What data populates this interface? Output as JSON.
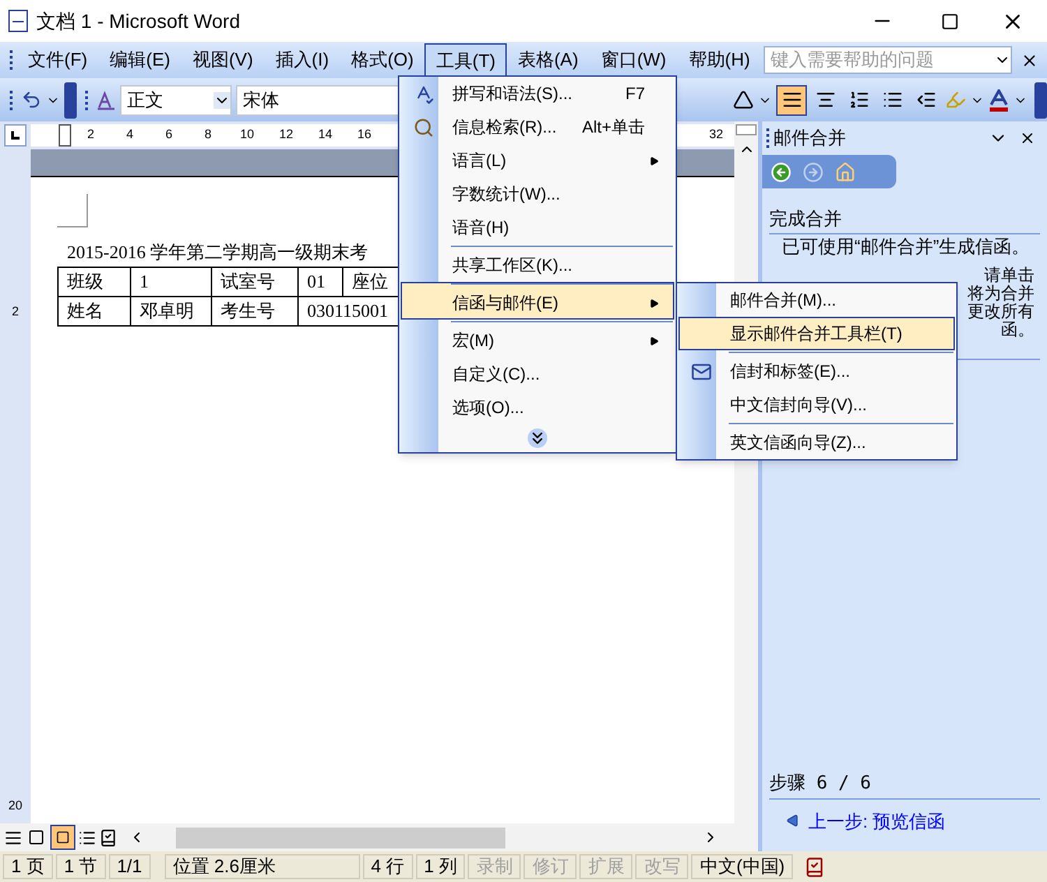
{
  "window": {
    "title": "文档 1 - Microsoft Word"
  },
  "menu_bar": {
    "items": [
      {
        "label": "文件(F)",
        "selected": false
      },
      {
        "label": "编辑(E)",
        "selected": false
      },
      {
        "label": "视图(V)",
        "selected": false
      },
      {
        "label": "插入(I)",
        "selected": false
      },
      {
        "label": "格式(O)",
        "selected": false
      },
      {
        "label": "工具(T)",
        "selected": true
      },
      {
        "label": "表格(A)",
        "selected": false
      },
      {
        "label": "窗口(W)",
        "selected": false
      },
      {
        "label": "帮助(H)",
        "selected": false
      }
    ],
    "help_box": {
      "placeholder": "键入需要帮助的问题"
    }
  },
  "toolbar": {
    "style": "正文",
    "font": "宋体",
    "justify_selected": true
  },
  "ruler": {
    "labels": [
      "2",
      "4",
      "6",
      "8",
      "10",
      "12",
      "14",
      "16"
    ],
    "right_label": "32",
    "vertical_labels": [
      "2",
      "20"
    ]
  },
  "document": {
    "heading": "2015-2016 学年第二学期高一级期末考",
    "table": [
      [
        "班级",
        "1",
        "试室号",
        "01",
        "座位"
      ],
      [
        "姓名",
        "邓卓明",
        "考生号",
        "030115001"
      ]
    ]
  },
  "tools_menu": {
    "items": [
      {
        "label": "拼写和语法(S)...",
        "shortcut": "F7",
        "kind": "spell",
        "submenu": false,
        "separator_before": false,
        "selected": false
      },
      {
        "label": "信息检索(R)...",
        "shortcut": "Alt+单击",
        "kind": "research",
        "submenu": false,
        "separator_before": false,
        "selected": false
      },
      {
        "label": "语言(L)",
        "submenu": true,
        "separator_before": false,
        "selected": false
      },
      {
        "label": "字数统计(W)...",
        "submenu": false,
        "separator_before": false,
        "selected": false
      },
      {
        "label": "语音(H)",
        "submenu": false,
        "separator_before": false,
        "selected": false
      },
      {
        "label": "共享工作区(K)...",
        "submenu": false,
        "separator_before": true,
        "selected": false
      },
      {
        "label": "信函与邮件(E)",
        "submenu": true,
        "separator_before": true,
        "selected": true
      },
      {
        "label": "宏(M)",
        "submenu": true,
        "separator_before": true,
        "selected": false
      },
      {
        "label": "自定义(C)...",
        "submenu": false,
        "separator_before": false,
        "selected": false
      },
      {
        "label": "选项(O)...",
        "submenu": false,
        "separator_before": false,
        "selected": false
      }
    ]
  },
  "mail_submenu": {
    "items": [
      {
        "label": "邮件合并(M)...",
        "separator_before": false,
        "selected": false
      },
      {
        "label": "显示邮件合并工具栏(T)",
        "separator_before": false,
        "selected": true
      },
      {
        "label": "信封和标签(E)...",
        "kind": "envelope",
        "separator_before": true,
        "selected": false
      },
      {
        "label": "中文信封向导(V)...",
        "separator_before": false,
        "selected": false
      },
      {
        "label": "英文信函向导(Z)...",
        "separator_before": true,
        "selected": false
      }
    ]
  },
  "task_pane": {
    "title": "邮件合并",
    "section": "完成合并",
    "text": "已可使用“邮件合并”生成信函。",
    "fragments": [
      "请单击",
      "将为合并",
      "更改所有",
      "函。"
    ],
    "step": "步骤 6 / 6",
    "back_link": "上一步: 预览信函"
  },
  "status_bar": {
    "items": [
      {
        "label": "1 页",
        "disabled": false
      },
      {
        "label": "1 节",
        "disabled": false
      },
      {
        "label": "1/1",
        "disabled": false
      },
      {
        "label": "位置 2.6厘米",
        "disabled": false
      },
      {
        "label": "4 行",
        "disabled": false
      },
      {
        "label": "1 列",
        "disabled": false
      },
      {
        "label": "录制",
        "disabled": true
      },
      {
        "label": "修订",
        "disabled": true
      },
      {
        "label": "扩展",
        "disabled": true
      },
      {
        "label": "改写",
        "disabled": true
      },
      {
        "label": "中文(中国)",
        "disabled": false
      }
    ]
  }
}
